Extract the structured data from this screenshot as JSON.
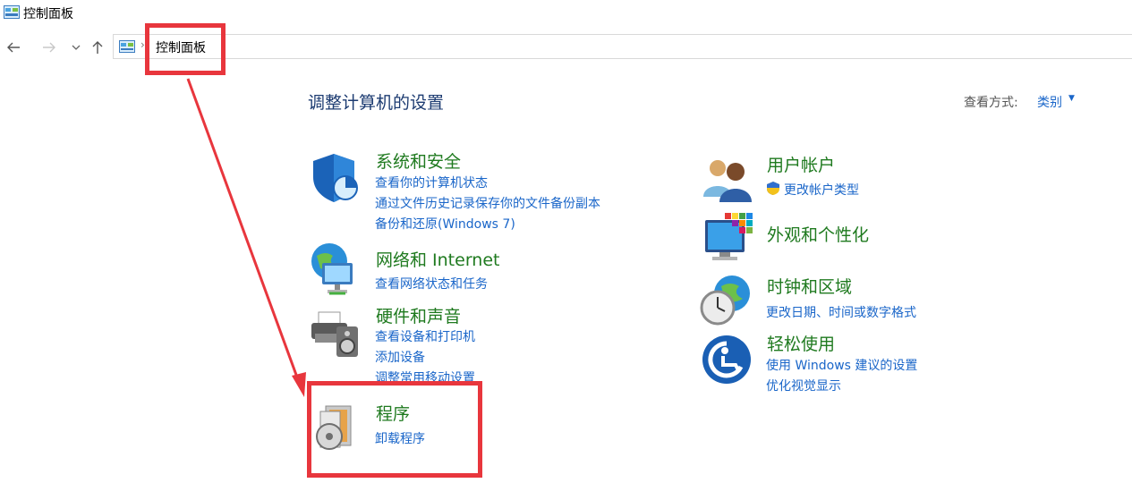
{
  "window": {
    "title": "控制面板"
  },
  "nav": {
    "back_icon": "arrow-left-icon",
    "forward_icon": "arrow-right-icon",
    "history_icon": "chevron-down-icon",
    "up_icon": "arrow-up-icon",
    "breadcrumb": [
      "控制面板"
    ]
  },
  "header": {
    "title": "调整计算机的设置",
    "view_label": "查看方式:",
    "view_value": "类别"
  },
  "categories_left": [
    {
      "title": "系统和安全",
      "icon": "shield-icon",
      "links": [
        "查看你的计算机状态",
        "通过文件历史记录保存你的文件备份副本",
        "备份和还原(Windows 7)"
      ]
    },
    {
      "title": "网络和 Internet",
      "icon": "network-globe-icon",
      "links": [
        "查看网络状态和任务"
      ]
    },
    {
      "title": "硬件和声音",
      "icon": "printer-speaker-icon",
      "links": [
        "查看设备和打印机",
        "添加设备",
        "调整常用移动设置"
      ]
    },
    {
      "title": "程序",
      "icon": "programs-disc-icon",
      "links": [
        "卸载程序"
      ]
    }
  ],
  "categories_right": [
    {
      "title": "用户帐户",
      "icon": "users-icon",
      "links": [
        "更改帐户类型"
      ]
    },
    {
      "title": "外观和个性化",
      "icon": "monitor-colors-icon",
      "links": []
    },
    {
      "title": "时钟和区域",
      "icon": "clock-globe-icon",
      "links": [
        "更改日期、时间或数字格式"
      ]
    },
    {
      "title": "轻松使用",
      "icon": "ease-of-access-icon",
      "links": [
        "使用 Windows 建议的设置",
        "优化视觉显示"
      ]
    }
  ],
  "colors": {
    "category_title": "#1f7a1f",
    "link": "#1a66c9",
    "page_title": "#1c3b71",
    "annotation": "#e8363d"
  }
}
